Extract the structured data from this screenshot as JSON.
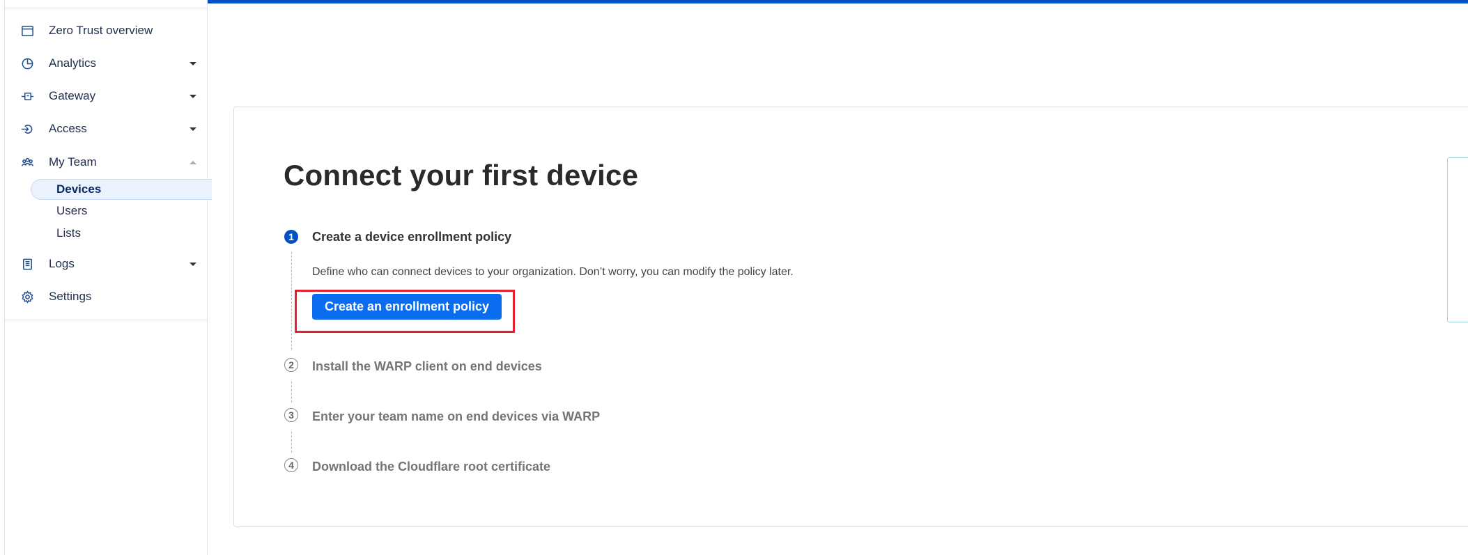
{
  "sidebar": {
    "items": [
      {
        "label": "Zero Trust overview",
        "icon": "browser-window-icon"
      },
      {
        "label": "Analytics",
        "icon": "pie-chart-icon"
      },
      {
        "label": "Gateway",
        "icon": "gateway-icon"
      },
      {
        "label": "Access",
        "icon": "access-icon"
      },
      {
        "label": "My Team",
        "icon": "team-icon"
      },
      {
        "label": "Logs",
        "icon": "logs-icon"
      },
      {
        "label": "Settings",
        "icon": "gear-icon"
      }
    ],
    "my_team_subitems": [
      "Devices",
      "Users",
      "Lists"
    ],
    "active_subitem": "Devices"
  },
  "main": {
    "title": "Connect your first device",
    "steps": [
      {
        "number": "1",
        "title": "Create a device enrollment policy",
        "state": "active"
      },
      {
        "number": "2",
        "title": "Install the WARP client on end devices",
        "state": "pending"
      },
      {
        "number": "3",
        "title": "Enter your team name on end devices via WARP",
        "state": "pending"
      },
      {
        "number": "4",
        "title": "Download the Cloudflare root certificate",
        "state": "pending"
      }
    ],
    "step1_description": "Define who can connect devices to your organization. Don’t worry, you can modify the policy later.",
    "create_button_label": "Create an enrollment policy"
  },
  "colors": {
    "accent": "#0051c3",
    "button": "#0a6df0",
    "highlight": "#e3222d",
    "active_nav_bg": "#eaf2fd"
  }
}
